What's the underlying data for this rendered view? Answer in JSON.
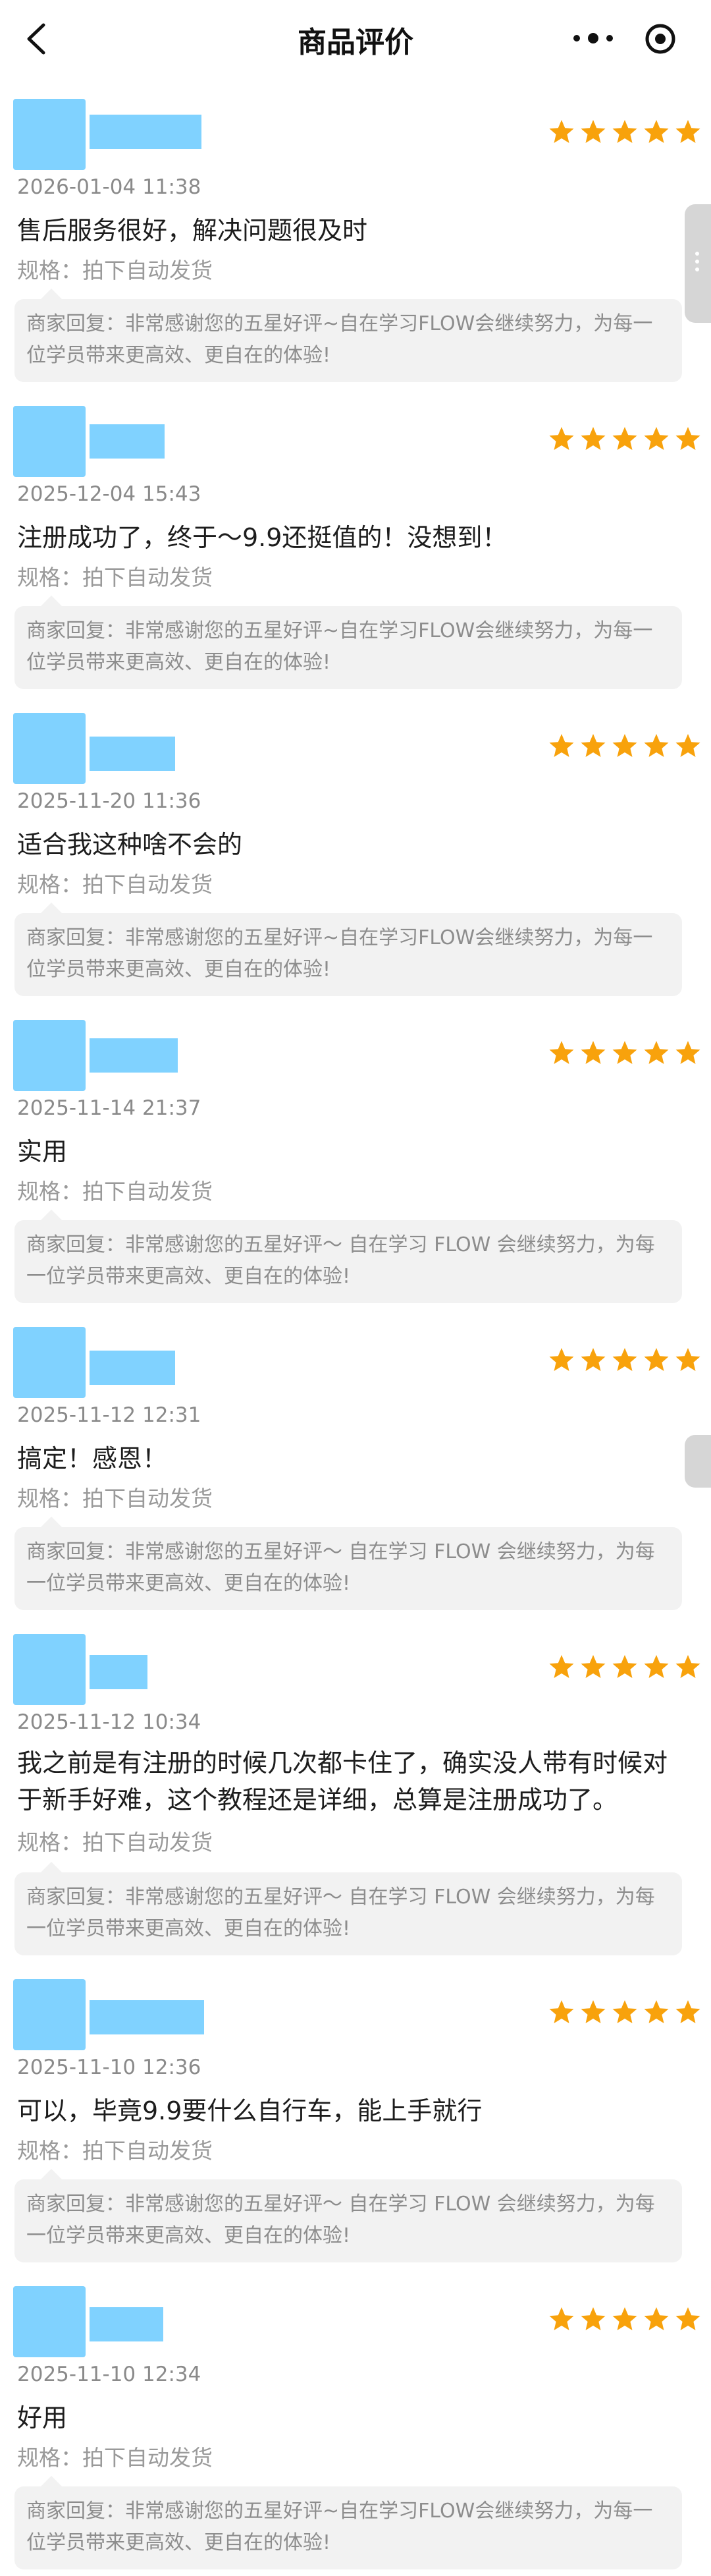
{
  "header": {
    "title": "商品评价",
    "back_icon": "back-arrow-icon",
    "more_icon": "more-dots-icon",
    "target_icon": "record-icon"
  },
  "colors": {
    "star": "#f8a20c",
    "avatar_placeholder": "#80d2ff",
    "reply_bg": "#f2f2f2"
  },
  "reviews": [
    {
      "rating": 5,
      "time": "2026-01-04 11:38",
      "content": "售后服务很好，解决问题很及时",
      "spec": "规格：拍下自动发货",
      "reply": "商家回复：非常感谢您的五星好评~自在学习FLOW会继续努力，为每一位学员带来更高效、更自在的体验!"
    },
    {
      "rating": 5,
      "time": "2025-12-04 15:43",
      "content": "注册成功了，终于～9.9还挺值的！没想到！",
      "spec": "规格：拍下自动发货",
      "reply": "商家回复：非常感谢您的五星好评~自在学习FLOW会继续努力，为每一位学员带来更高效、更自在的体验!"
    },
    {
      "rating": 5,
      "time": "2025-11-20 11:36",
      "content": "适合我这种啥不会的",
      "spec": "规格：拍下自动发货",
      "reply": "商家回复：非常感谢您的五星好评~自在学习FLOW会继续努力，为每一位学员带来更高效、更自在的体验!"
    },
    {
      "rating": 5,
      "time": "2025-11-14 21:37",
      "content": "实用",
      "spec": "规格：拍下自动发货",
      "reply": "商家回复：非常感谢您的五星好评～ 自在学习 FLOW 会继续努力，为每一位学员带来更高效、更自在的体验!"
    },
    {
      "rating": 5,
      "time": "2025-11-12 12:31",
      "content": "搞定！感恩！",
      "spec": "规格：拍下自动发货",
      "reply": "商家回复：非常感谢您的五星好评～ 自在学习 FLOW 会继续努力，为每一位学员带来更高效、更自在的体验!"
    },
    {
      "rating": 5,
      "time": "2025-11-12 10:34",
      "content": "我之前是有注册的时候几次都卡住了，确实没人带有时候对于新手好难，这个教程还是详细，总算是注册成功了。",
      "spec": "规格：拍下自动发货",
      "reply": "商家回复：非常感谢您的五星好评～ 自在学习 FLOW 会继续努力，为每一位学员带来更高效、更自在的体验!"
    },
    {
      "rating": 5,
      "time": "2025-11-10 12:36",
      "content": "可以，毕竟9.9要什么自行车，能上手就行",
      "spec": "规格：拍下自动发货",
      "reply": "商家回复：非常感谢您的五星好评～ 自在学习 FLOW 会继续努力，为每一位学员带来更高效、更自在的体验!"
    },
    {
      "rating": 5,
      "time": "2025-11-10 12:34",
      "content": "好用",
      "spec": "规格：拍下自动发货",
      "reply": "商家回复：非常感谢您的五星好评~自在学习FLOW会继续努力，为每一位学员带来更高效、更自在的体验!"
    }
  ]
}
